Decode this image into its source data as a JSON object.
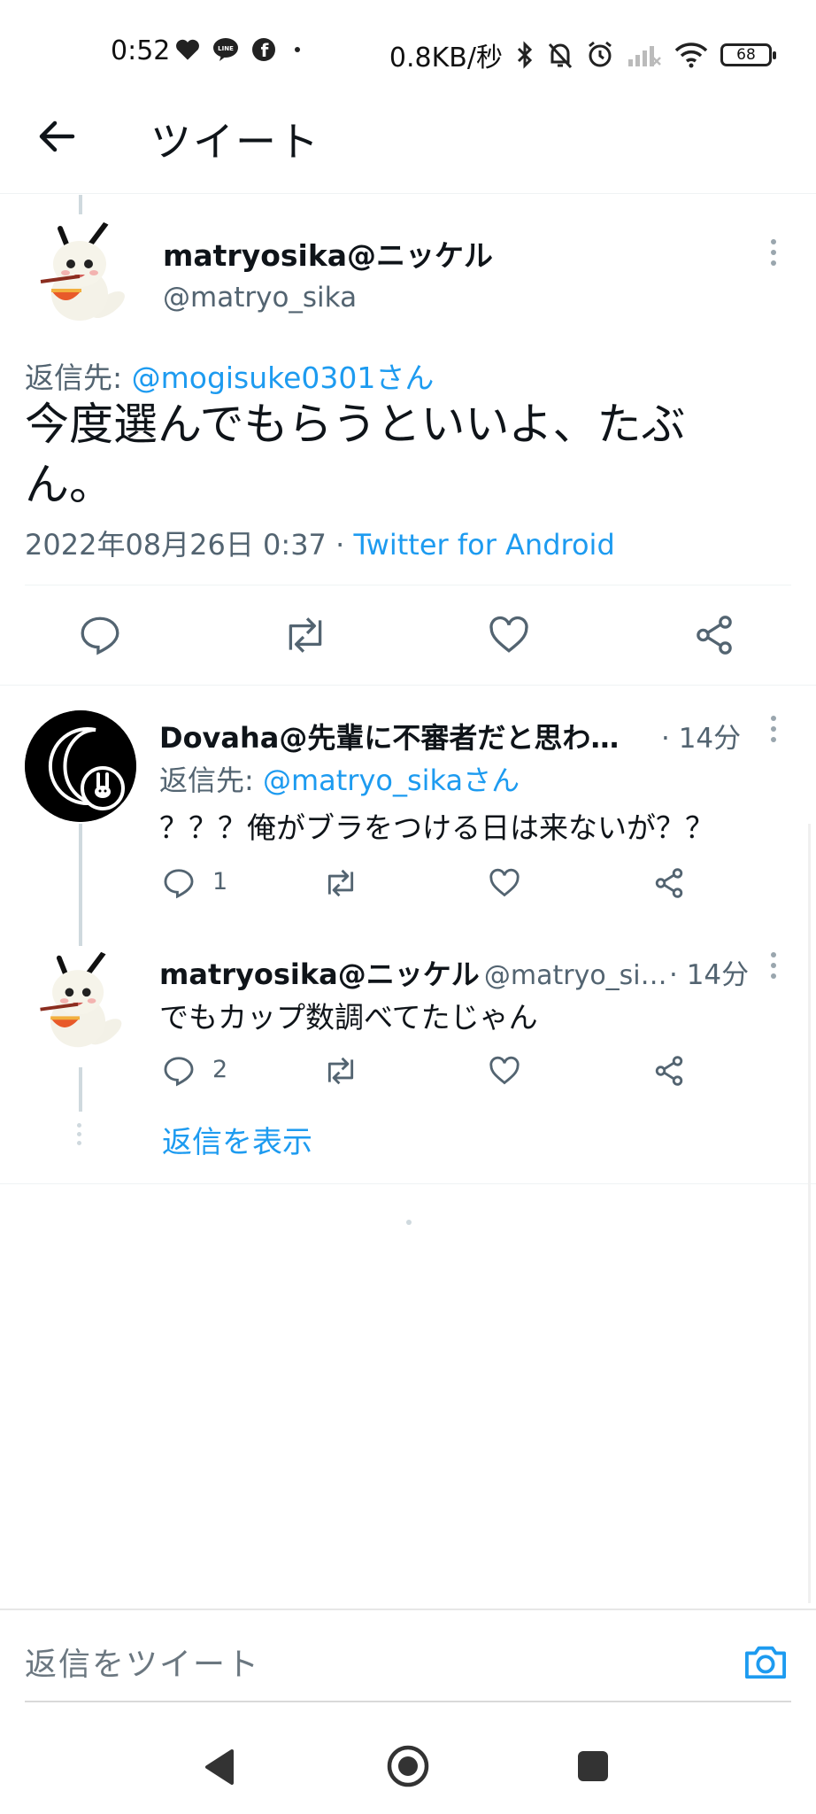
{
  "status_bar": {
    "time": "0:52",
    "speed": "0.8KB/秒",
    "battery": "68"
  },
  "header": {
    "title": "ツイート"
  },
  "main_tweet": {
    "name": "matryosika@ニッケル",
    "handle": "@matryo_sika",
    "reply_prefix": "返信先: ",
    "reply_to": "@mogisuke0301さん",
    "text_line1": "今度選んでもらうといいよ、たぶ",
    "text_line2": "ん。",
    "date": "2022年08月26日 0:37 · ",
    "source": "Twitter for Android"
  },
  "replies": [
    {
      "name": "Dovaha@先輩に不審者だと思わ…",
      "time": "· 14分",
      "reply_prefix": "返信先: ",
      "reply_to": "@matryo_sikaさん",
      "text": "？？？俺がブラをつける日は来ないが？？",
      "reply_count": "1"
    },
    {
      "name": "matryosika@ニッケル",
      "handle": "@matryo_si…",
      "time": "· 14分",
      "text": "でもカップ数調べてたじゃん",
      "reply_count": "2",
      "show_replies": "返信を表示"
    }
  ],
  "composer": {
    "placeholder": "返信をツイート"
  },
  "colors": {
    "accent": "#1d9bf0",
    "text": "#0f1419",
    "secondary": "#536471"
  }
}
